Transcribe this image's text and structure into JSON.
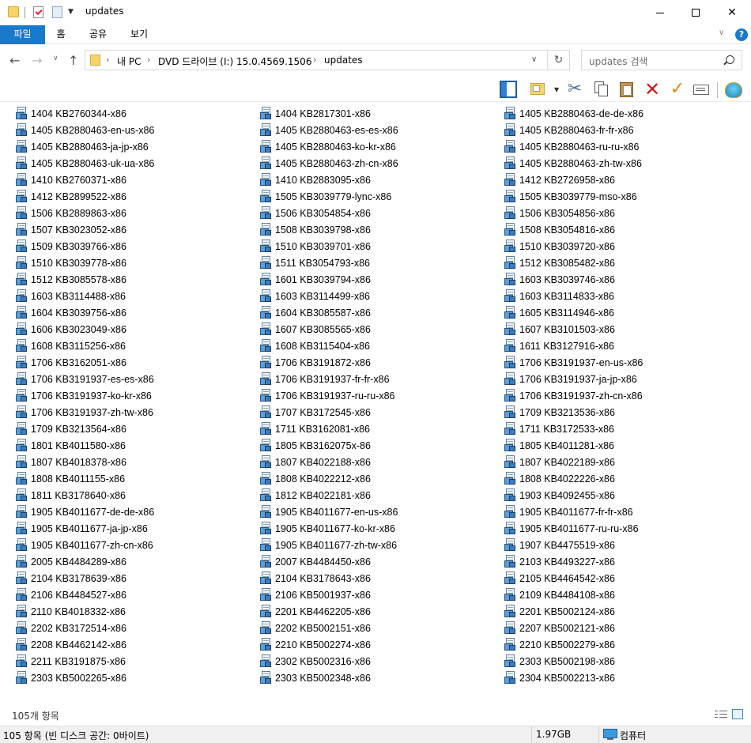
{
  "window": {
    "title": "updates"
  },
  "ribbon": {
    "tabs": [
      "파일",
      "홈",
      "공유",
      "보기"
    ]
  },
  "address": {
    "crumbs": [
      "내 PC",
      "DVD 드라이브 (I:) 15.0.4569.1506",
      "updates"
    ],
    "search_placeholder": "updates 검색"
  },
  "files": {
    "col1": [
      "1404 KB2760344-x86",
      "1405 KB2880463-en-us-x86",
      "1405 KB2880463-ja-jp-x86",
      "1405 KB2880463-uk-ua-x86",
      "1410 KB2760371-x86",
      "1412 KB2899522-x86",
      "1506 KB2889863-x86",
      "1507 KB3023052-x86",
      "1509 KB3039766-x86",
      "1510 KB3039778-x86",
      "1512 KB3085578-x86",
      "1603 KB3114488-x86",
      "1604 KB3039756-x86",
      "1606 KB3023049-x86",
      "1608 KB3115256-x86",
      "1706 KB3162051-x86",
      "1706 KB3191937-es-es-x86",
      "1706 KB3191937-ko-kr-x86",
      "1706 KB3191937-zh-tw-x86",
      "1709 KB3213564-x86",
      "1801 KB4011580-x86",
      "1807 KB4018378-x86",
      "1808 KB4011155-x86",
      "1811 KB3178640-x86",
      "1905 KB4011677-de-de-x86",
      "1905 KB4011677-ja-jp-x86",
      "1905 KB4011677-zh-cn-x86",
      "2005 KB4484289-x86",
      "2104 KB3178639-x86",
      "2106 KB4484527-x86",
      "2110 KB4018332-x86",
      "2202 KB3172514-x86",
      "2208 KB4462142-x86",
      "2211 KB3191875-x86",
      "2303 KB5002265-x86"
    ],
    "col2": [
      "1404 KB2817301-x86",
      "1405 KB2880463-es-es-x86",
      "1405 KB2880463-ko-kr-x86",
      "1405 KB2880463-zh-cn-x86",
      "1410 KB2883095-x86",
      "1505 KB3039779-lync-x86",
      "1506 KB3054854-x86",
      "1508 KB3039798-x86",
      "1510 KB3039701-x86",
      "1511 KB3054793-x86",
      "1601 KB3039794-x86",
      "1603 KB3114499-x86",
      "1604 KB3085587-x86",
      "1607 KB3085565-x86",
      "1608 KB3115404-x86",
      "1706 KB3191872-x86",
      "1706 KB3191937-fr-fr-x86",
      "1706 KB3191937-ru-ru-x86",
      "1707 KB3172545-x86",
      "1711 KB3162081-x86",
      "1805 KB3162075x-86",
      "1807 KB4022188-x86",
      "1808 KB4022212-x86",
      "1812 KB4022181-x86",
      "1905 KB4011677-en-us-x86",
      "1905 KB4011677-ko-kr-x86",
      "1905 KB4011677-zh-tw-x86",
      "2007 KB4484450-x86",
      "2104 KB3178643-x86",
      "2106 KB5001937-x86",
      "2201 KB4462205-x86",
      "2202 KB5002151-x86",
      "2210 KB5002274-x86",
      "2302 KB5002316-x86",
      "2303 KB5002348-x86"
    ],
    "col3": [
      "1405 KB2880463-de-de-x86",
      "1405 KB2880463-fr-fr-x86",
      "1405 KB2880463-ru-ru-x86",
      "1405 KB2880463-zh-tw-x86",
      "1412 KB2726958-x86",
      "1505 KB3039779-mso-x86",
      "1506 KB3054856-x86",
      "1508 KB3054816-x86",
      "1510 KB3039720-x86",
      "1512 KB3085482-x86",
      "1603 KB3039746-x86",
      "1603 KB3114833-x86",
      "1605 KB3114946-x86",
      "1607 KB3101503-x86",
      "1611 KB3127916-x86",
      "1706 KB3191937-en-us-x86",
      "1706 KB3191937-ja-jp-x86",
      "1706 KB3191937-zh-cn-x86",
      "1709 KB3213536-x86",
      "1711 KB3172533-x86",
      "1805 KB4011281-x86",
      "1807 KB4022189-x86",
      "1808 KB4022226-x86",
      "1903 KB4092455-x86",
      "1905 KB4011677-fr-fr-x86",
      "1905 KB4011677-ru-ru-x86",
      "1907 KB4475519-x86",
      "2103 KB4493227-x86",
      "2105 KB4464542-x86",
      "2109 KB4484108-x86",
      "2201 KB5002124-x86",
      "2207 KB5002121-x86",
      "2210 KB5002279-x86",
      "2303 KB5002198-x86",
      "2304 KB5002213-x86"
    ]
  },
  "footer": {
    "item_count": "105개 항목"
  },
  "status": {
    "text": "105 항목 (빈 디스크 공간: 0바이트)",
    "size": "1.97GB",
    "location": "컴퓨터"
  },
  "colors": {
    "accent": "#1979ca",
    "delete": "#d81818",
    "rename": "#f08010"
  }
}
